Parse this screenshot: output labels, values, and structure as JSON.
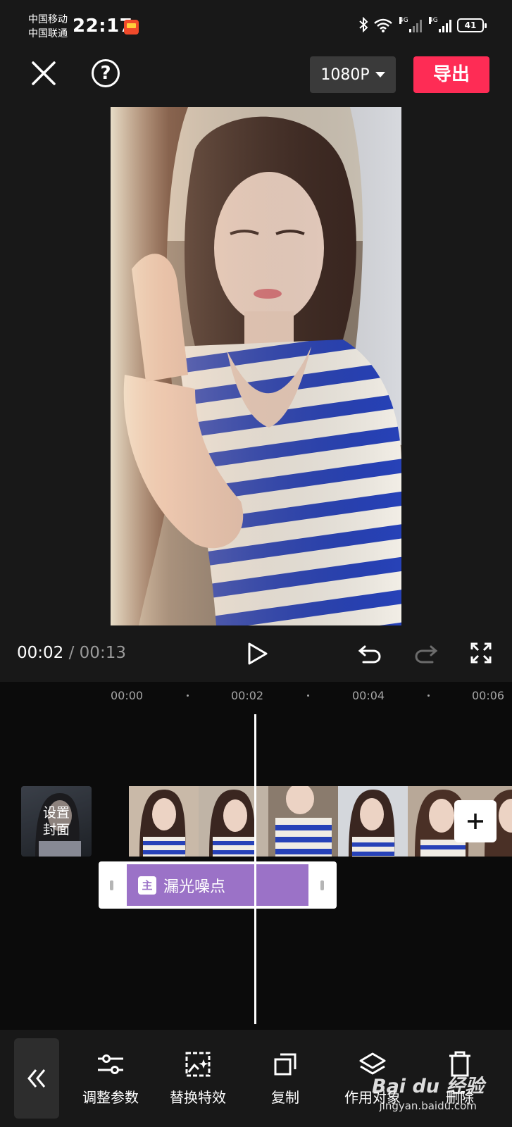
{
  "status_bar": {
    "carrier_1": "中国移动",
    "carrier_2": "中国联通",
    "time": "22:17",
    "network_1": "4G",
    "network_2": "4G",
    "battery": "41"
  },
  "toolbar": {
    "resolution": "1080P",
    "export_label": "导出",
    "help_label": "?"
  },
  "playback": {
    "current_time": "00:02",
    "separator": "/",
    "total_time": "00:13"
  },
  "timeline": {
    "ruler": [
      "00:00",
      "00:02",
      "00:04",
      "00:06"
    ],
    "cover_label_1": "设置",
    "cover_label_2": "封面",
    "effect_icon": "主",
    "effect_label": "漏光噪点"
  },
  "bottom_toolbar": {
    "tools": [
      {
        "label": "调整参数",
        "icon": "sliders-icon"
      },
      {
        "label": "替换特效",
        "icon": "replace-effect-icon"
      },
      {
        "label": "复制",
        "icon": "copy-icon"
      },
      {
        "label": "作用对象",
        "icon": "layers-icon"
      },
      {
        "label": "删除",
        "icon": "delete-icon"
      }
    ]
  },
  "watermark": {
    "main": "Bai du 经验",
    "sub": "jingyan.baidu.com"
  },
  "colors": {
    "background": "#181818",
    "export": "#fe2c55",
    "effect_clip": "#9b72c7"
  }
}
